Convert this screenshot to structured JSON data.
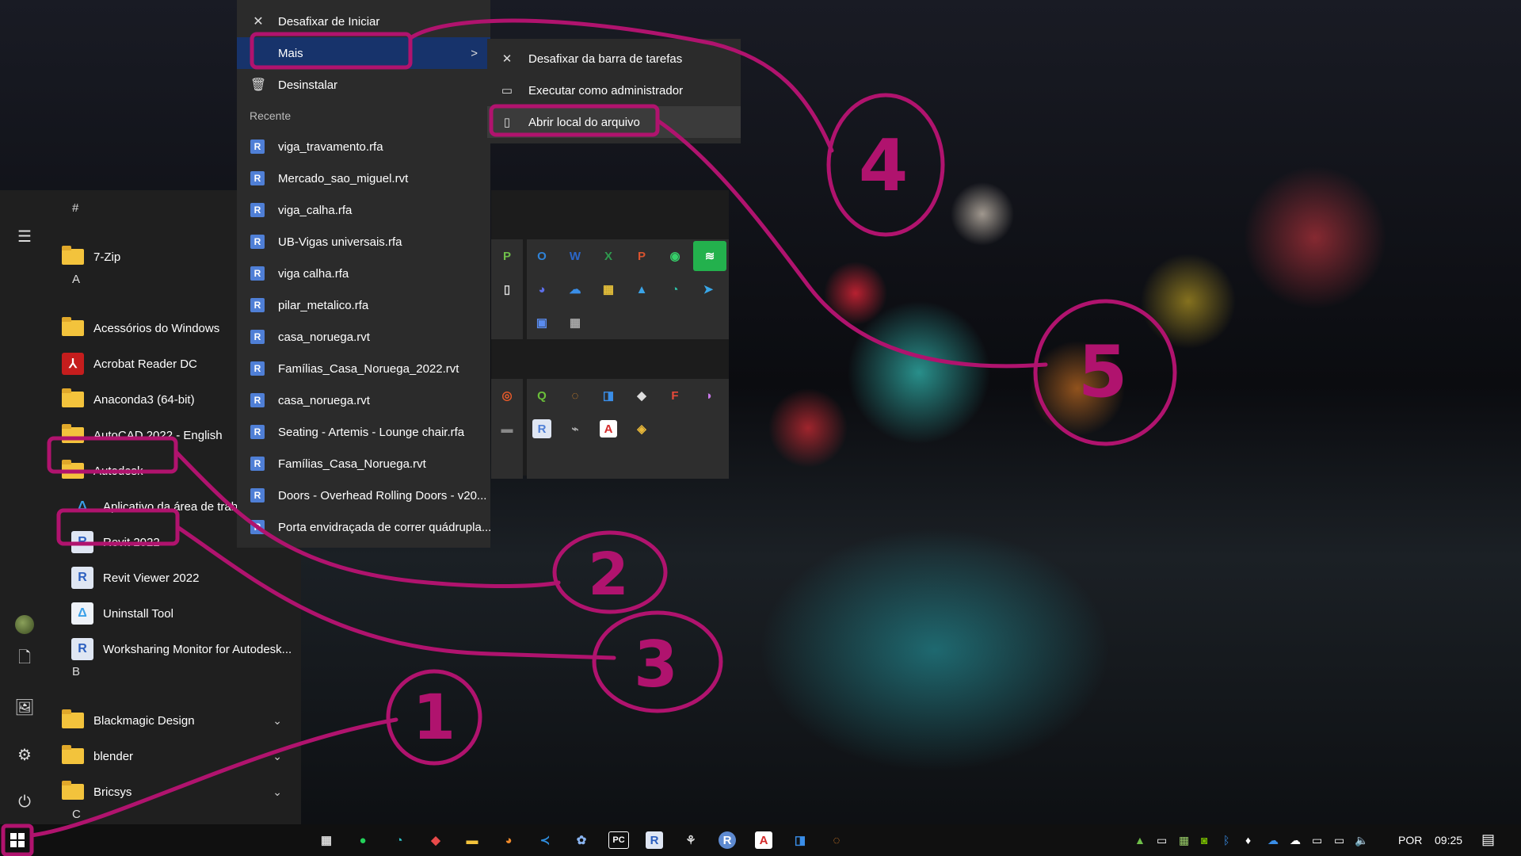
{
  "context_menu": {
    "items": [
      {
        "label": "Desafixar de Iniciar",
        "icon": "unpin-icon"
      },
      {
        "label": "Mais",
        "icon": "",
        "arrow": ">"
      },
      {
        "label": "Desinstalar",
        "icon": "trash-icon"
      }
    ],
    "recent_header": "Recente",
    "recent": [
      "viga_travamento.rfa",
      "Mercado_sao_miguel.rvt",
      "viga_calha.rfa",
      "UB-Vigas universais.rfa",
      "viga calha.rfa",
      "pilar_metalico.rfa",
      "casa_noruega.rvt",
      "Famílias_Casa_Noruega_2022.rvt",
      "casa_noruega.rvt",
      "Seating - Artemis - Lounge chair.rfa",
      "Famílias_Casa_Noruega.rvt",
      "Doors - Overhead Rolling Doors - v20...",
      "Porta envidraçada de correr quádrupla..."
    ]
  },
  "submenu": {
    "items": [
      {
        "label": "Desafixar da barra de tarefas",
        "icon": "unpin-taskbar-icon"
      },
      {
        "label": "Executar como administrador",
        "icon": "admin-shield-icon"
      },
      {
        "label": "Abrir local do arquivo",
        "icon": "folder-location-icon"
      }
    ]
  },
  "app_list": {
    "headers": [
      "#",
      "A",
      "B",
      "C"
    ],
    "items": [
      {
        "label": "7-Zip",
        "type": "folder"
      },
      {
        "label": "Acessórios do Windows",
        "type": "folder"
      },
      {
        "label": "Acrobat Reader DC",
        "type": "acrobat"
      },
      {
        "label": "Anaconda3 (64-bit)",
        "type": "folder"
      },
      {
        "label": "AutoCAD 2022 - English",
        "type": "folder"
      },
      {
        "label": "Autodesk",
        "type": "folder"
      },
      {
        "label": "Aplicativo da área de trab",
        "type": "autodesk"
      },
      {
        "label": "Revit 2022",
        "type": "revit"
      },
      {
        "label": "Revit Viewer 2022",
        "type": "revit"
      },
      {
        "label": "Uninstall Tool",
        "type": "autodesk"
      },
      {
        "label": "Worksharing Monitor for Autodesk...",
        "type": "revit"
      },
      {
        "label": "Blackmagic Design",
        "type": "folder",
        "expand": "⌄"
      },
      {
        "label": "blender",
        "type": "folder",
        "expand": "⌄"
      },
      {
        "label": "Bricsys",
        "type": "folder",
        "expand": "⌄"
      }
    ]
  },
  "annotations": [
    "1",
    "2",
    "3",
    "4",
    "5"
  ],
  "taskbar": {
    "tray": {
      "language": "POR",
      "time": "09:25"
    }
  },
  "colors": {
    "annotation": "#b0136e",
    "menu_bg": "#2b2b2b",
    "selected": "#17336b",
    "folder": "#f3c33c"
  }
}
